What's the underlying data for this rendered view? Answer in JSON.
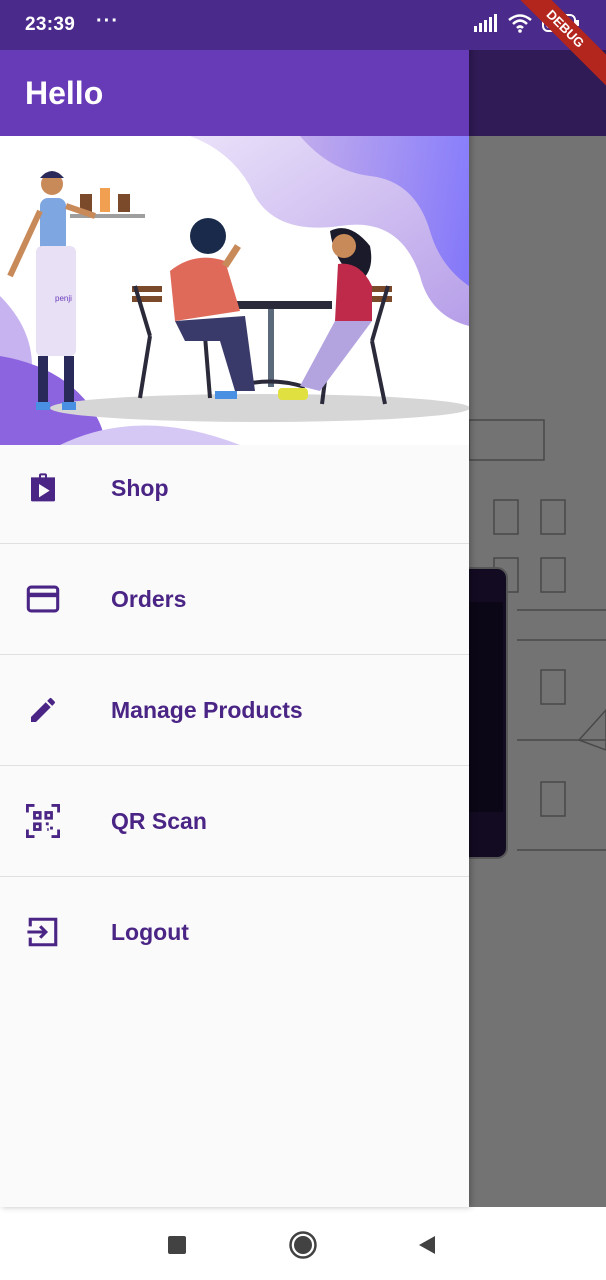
{
  "status_bar": {
    "time": "23:39",
    "dots": "···",
    "debug_label": "DEBUG"
  },
  "drawer": {
    "title": "Hello",
    "items": [
      {
        "label": "Shop",
        "icon": "shop-icon"
      },
      {
        "label": "Orders",
        "icon": "credit-card-icon"
      },
      {
        "label": "Manage Products",
        "icon": "edit-pencil-icon"
      },
      {
        "label": "QR Scan",
        "icon": "qr-scan-icon"
      },
      {
        "label": "Logout",
        "icon": "logout-icon"
      }
    ]
  },
  "banner": {
    "apron_text": "penji"
  },
  "colors": {
    "primary": "#673ab7",
    "status_bar": "#4a2a8a",
    "menu_text": "#4a2585",
    "drawer_bg": "#fafafa"
  },
  "nav_bar": {
    "buttons": [
      "recents-square-icon",
      "home-circle-icon",
      "back-triangle-icon"
    ]
  }
}
